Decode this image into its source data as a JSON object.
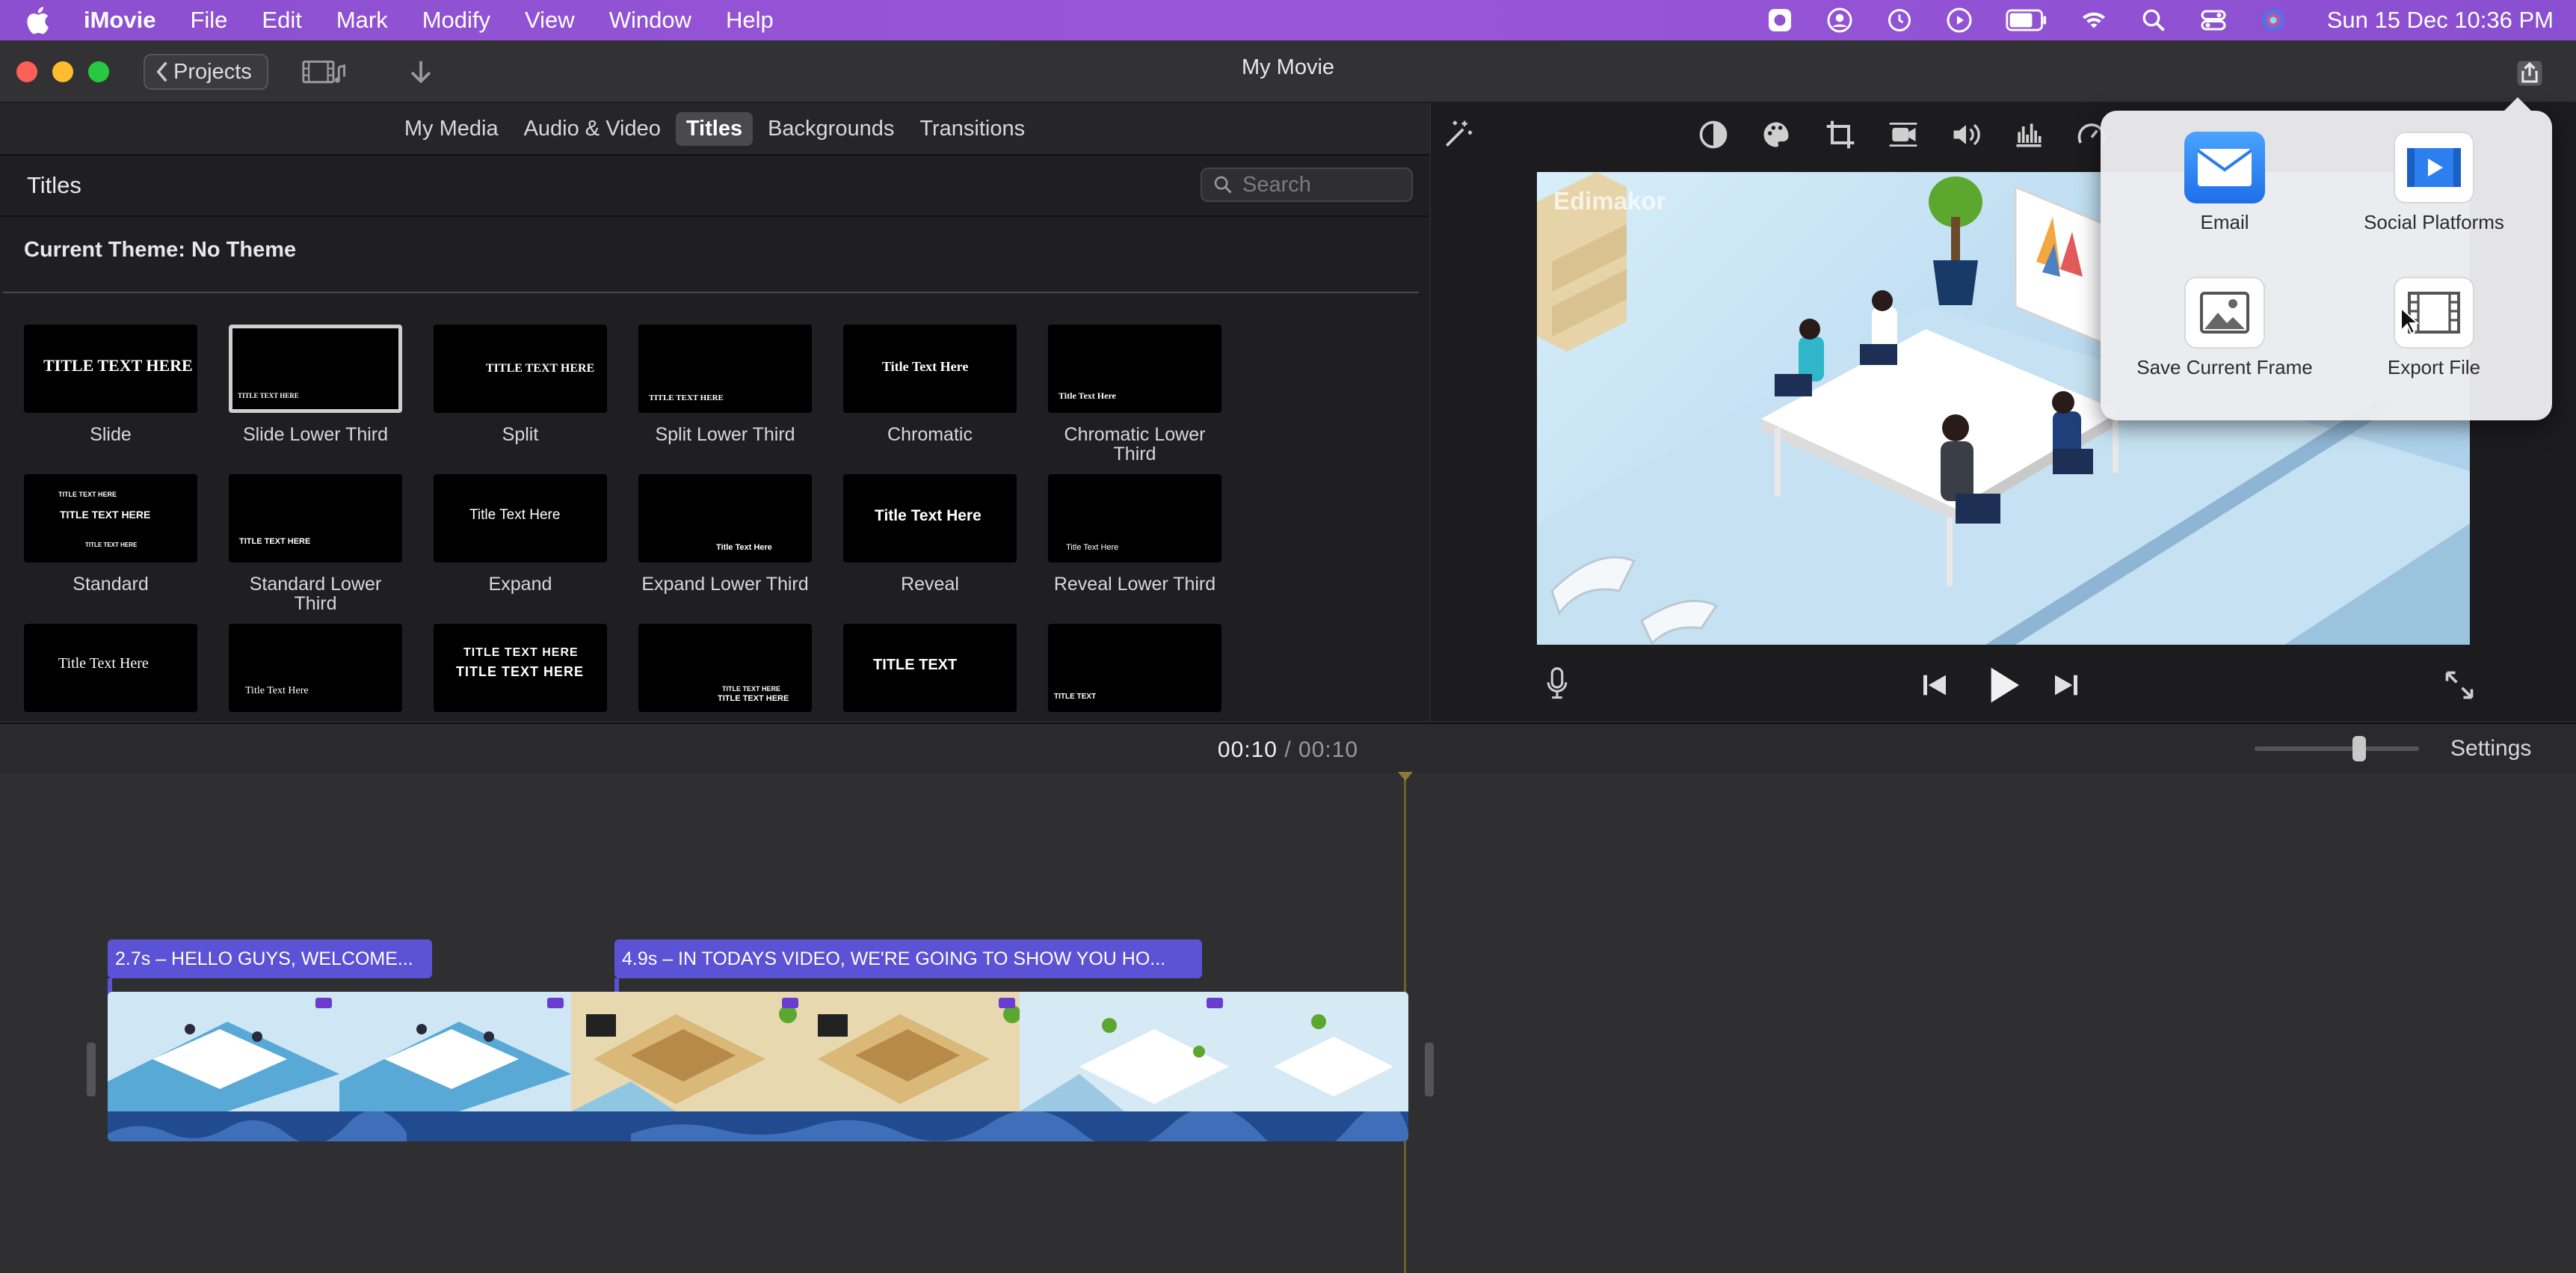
{
  "menubar": {
    "app_name": "iMovie",
    "items": [
      "File",
      "Edit",
      "Mark",
      "Modify",
      "View",
      "Window",
      "Help"
    ],
    "clock": "Sun 15 Dec  10:36 PM"
  },
  "toolbar": {
    "projects_label": "Projects",
    "window_title": "My Movie"
  },
  "browser": {
    "tabs": [
      {
        "label": "My Media",
        "active": false
      },
      {
        "label": "Audio & Video",
        "active": false
      },
      {
        "label": "Titles",
        "active": true
      },
      {
        "label": "Backgrounds",
        "active": false
      },
      {
        "label": "Transitions",
        "active": false
      }
    ],
    "section_title": "Titles",
    "search_placeholder": "Search",
    "current_theme": "Current Theme: No Theme",
    "titles": [
      {
        "label": "Slide",
        "preview": "TITLE TEXT HERE"
      },
      {
        "label": "Slide Lower Third",
        "preview": "TITLE TEXT HERE",
        "selected": true
      },
      {
        "label": "Split",
        "preview": "TITLE TEXT HERE"
      },
      {
        "label": "Split Lower Third",
        "preview": "TITLE TEXT HERE"
      },
      {
        "label": "Chromatic",
        "preview": "Title Text Here"
      },
      {
        "label": "Chromatic Lower Third",
        "preview": "Title Text Here"
      },
      {
        "label": "Standard",
        "preview": "TITLE TEXT HERE"
      },
      {
        "label": "Standard Lower Third",
        "preview": "TITLE TEXT HERE"
      },
      {
        "label": "Expand",
        "preview": "Title Text Here"
      },
      {
        "label": "Expand Lower Third",
        "preview": "Title Text Here"
      },
      {
        "label": "Reveal",
        "preview": "Title Text Here"
      },
      {
        "label": "Reveal Lower Third",
        "preview": "Title Text Here"
      },
      {
        "label": "",
        "preview": "Title Text Here"
      },
      {
        "label": "",
        "preview": "Title Text Here"
      },
      {
        "label": "",
        "preview": "TITLE TEXT HERE"
      },
      {
        "label": "",
        "preview": "TITLE TEXT HERE"
      },
      {
        "label": "",
        "preview": "TITLE TEXT"
      },
      {
        "label": "",
        "preview": "TITLE TEXT"
      }
    ]
  },
  "viewer": {
    "watermark": "Edimakor"
  },
  "share_menu": {
    "items": [
      {
        "label": "Email",
        "icon": "email-icon"
      },
      {
        "label": "Social Platforms",
        "icon": "social-platforms-icon"
      },
      {
        "label": "Save Current Frame",
        "icon": "save-frame-icon"
      },
      {
        "label": "Export File",
        "icon": "export-file-icon"
      }
    ]
  },
  "timeline": {
    "current_time": "00:10",
    "separator": "/",
    "total_time": "00:10",
    "settings_label": "Settings",
    "zoom_level": 0.65,
    "title_clips": [
      {
        "text": "2.7s – HELLO GUYS, WELCOME..."
      },
      {
        "text": "4.9s – IN TODAYS VIDEO, WE'RE GOING TO SHOW YOU HO..."
      }
    ]
  },
  "colors": {
    "menubar": "#9a56d8",
    "title_clip": "#5b52d6",
    "video_strip": "#1d4f9a",
    "playhead": "#8c7a3a"
  }
}
